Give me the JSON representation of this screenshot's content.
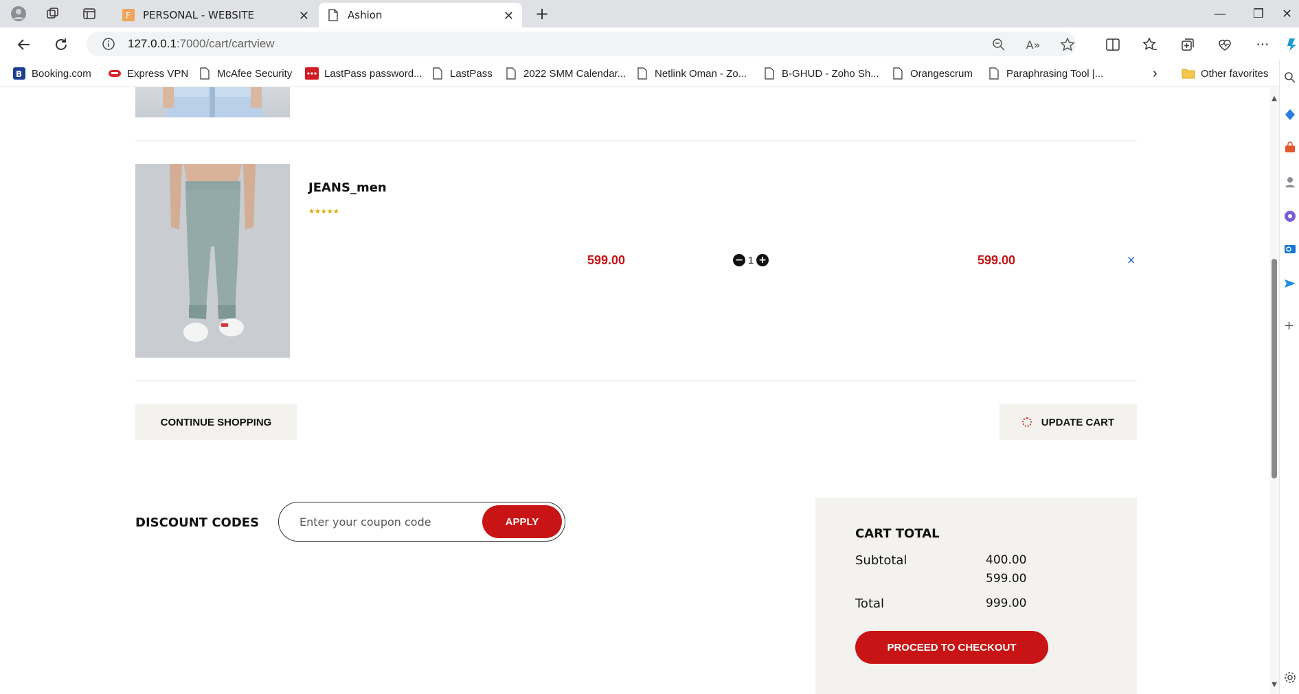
{
  "browser": {
    "tabs": [
      {
        "title": "PERSONAL - WEBSITE",
        "active": false
      },
      {
        "title": "Ashion",
        "active": true
      }
    ],
    "address": {
      "host": "127.0.0.1",
      "path": ":7000/cart/cartview"
    },
    "bookmarks": [
      {
        "label": "Booking.com",
        "icon": "booking-icon"
      },
      {
        "label": "Express VPN",
        "icon": "expressvpn-icon"
      },
      {
        "label": "McAfee Security",
        "icon": "page-icon"
      },
      {
        "label": "LastPass password...",
        "icon": "lastpass-icon"
      },
      {
        "label": "LastPass",
        "icon": "page-icon"
      },
      {
        "label": "2022 SMM Calendar...",
        "icon": "page-icon"
      },
      {
        "label": "Netlink Oman - Zo...",
        "icon": "page-icon"
      },
      {
        "label": "B-GHUD - Zoho Sh...",
        "icon": "page-icon"
      },
      {
        "label": "Orangescrum",
        "icon": "page-icon"
      },
      {
        "label": "Paraphrasing Tool |...",
        "icon": "page-icon"
      }
    ],
    "other_favorites": "Other favorites"
  },
  "cart": {
    "item": {
      "name": "JEANS_men",
      "rating": "★★★★★",
      "price": "599.00",
      "quantity": "1",
      "total": "599.00",
      "remove_symbol": "×"
    },
    "continue_label": "CONTINUE SHOPPING",
    "update_label": "UPDATE CART"
  },
  "discount": {
    "title": "DISCOUNT CODES",
    "placeholder": "Enter your coupon code",
    "apply_label": "APPLY"
  },
  "totals": {
    "title": "CART TOTAL",
    "subtotal_label": "Subtotal",
    "subtotal_values": [
      "400.00",
      "599.00"
    ],
    "total_label": "Total",
    "total_value": "999.00",
    "checkout_label": "PROCEED TO CHECKOUT"
  },
  "colors": {
    "accent": "#c81414",
    "panel": "#f3f2ee"
  }
}
